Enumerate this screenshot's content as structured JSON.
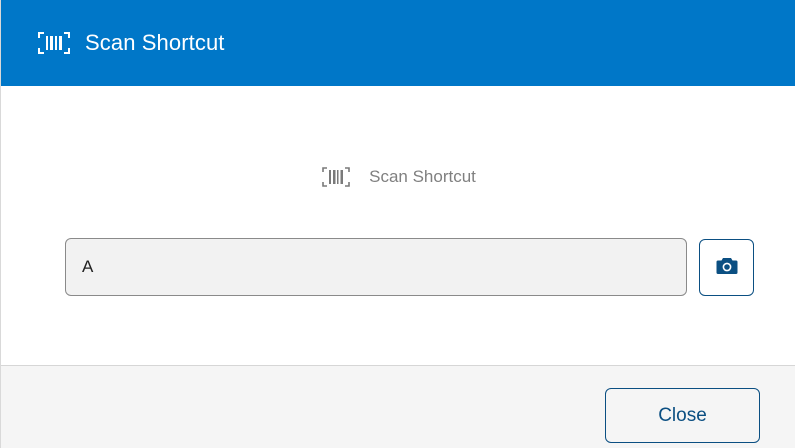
{
  "header": {
    "icon": "barcode-scan-icon",
    "title": "Scan Shortcut",
    "background": "#0077c8"
  },
  "body": {
    "subtitle_icon": "barcode-scan-icon",
    "subtitle": "Scan Shortcut",
    "input": {
      "value": "A",
      "placeholder": ""
    },
    "camera_button_icon": "camera-icon"
  },
  "footer": {
    "close_label": "Close"
  },
  "colors": {
    "accent": "#0077c8",
    "button_border": "#0b4f82"
  }
}
